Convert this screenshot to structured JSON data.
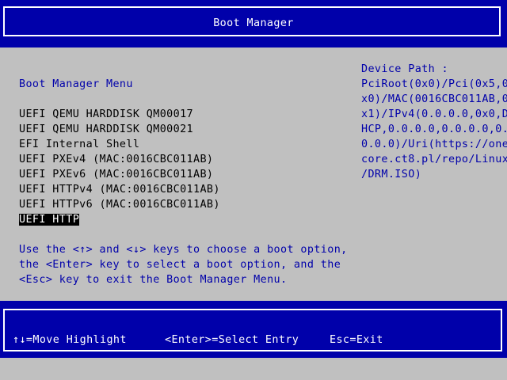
{
  "header": {
    "title": "Boot Manager"
  },
  "menu": {
    "title": "Boot Manager Menu",
    "items": [
      {
        "label": "UEFI QEMU HARDDISK QM00017",
        "selected": false
      },
      {
        "label": "UEFI QEMU HARDDISK QM00021",
        "selected": false
      },
      {
        "label": "EFI Internal Shell",
        "selected": false
      },
      {
        "label": "UEFI PXEv4 (MAC:0016CBC011AB)",
        "selected": false
      },
      {
        "label": "UEFI PXEv6 (MAC:0016CBC011AB)",
        "selected": false
      },
      {
        "label": "UEFI HTTPv4 (MAC:0016CBC011AB)",
        "selected": false
      },
      {
        "label": "UEFI HTTPv6 (MAC:0016CBC011AB)",
        "selected": false
      },
      {
        "label": "UEFI HTTP",
        "selected": true
      }
    ]
  },
  "help": {
    "lines": [
      "Use the <↑> and <↓> keys to choose a boot option,",
      "the <Enter> key to select a boot option, and the",
      "<Esc> key to exit the Boot Manager Menu."
    ]
  },
  "device_path": {
    "title": "Device Path :",
    "lines": [
      "PciRoot(0x0)/Pci(0x5,0",
      "x0)/MAC(0016CBC011AB,0",
      "x1)/IPv4(0.0.0.0,0x0,D",
      "HCP,0.0.0.0,0.0.0.0,0.",
      "0.0.0)/Uri(https://one",
      "core.ct8.pl/repo/Linux",
      "/DRM.ISO)"
    ]
  },
  "footer": {
    "move_highlight": "↑↓=Move Highlight",
    "select_entry": "<Enter>=Select Entry",
    "exit": "Esc=Exit"
  },
  "colors": {
    "bios_blue": "#0000aa",
    "panel_gray": "#c0c0c0",
    "text_white": "#ffffff",
    "text_black": "#000000"
  }
}
